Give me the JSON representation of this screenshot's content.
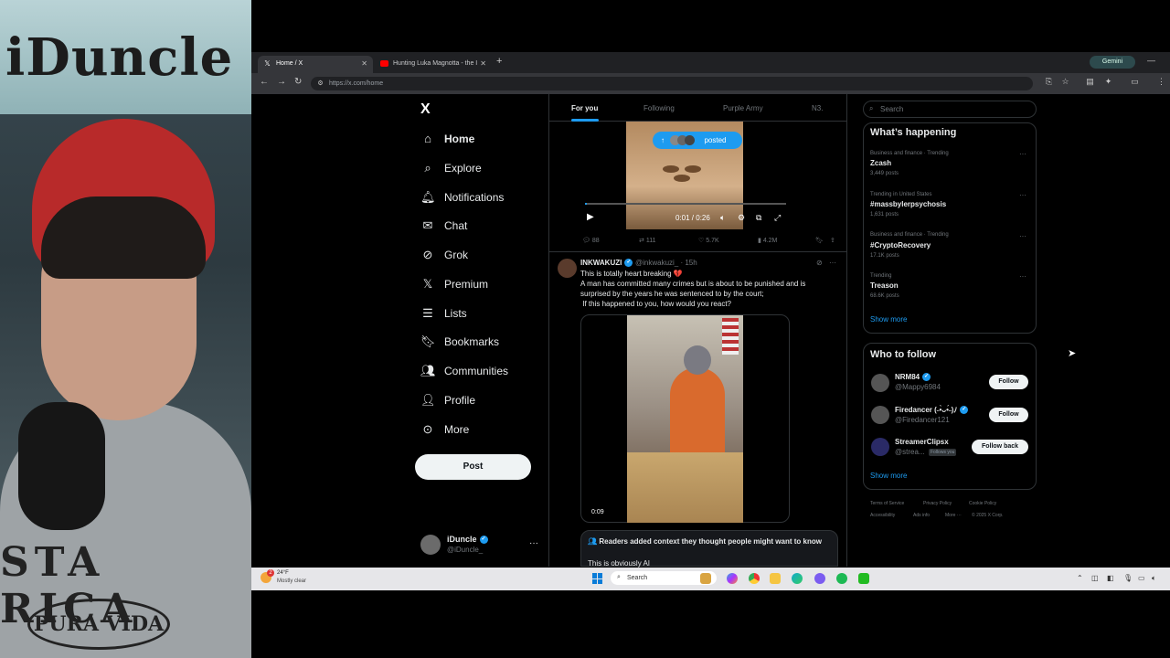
{
  "webcam": {
    "sign_text": "iDuncle",
    "shirt_text": "STA RICA",
    "shirt_logo": "PURA VIDA"
  },
  "browser": {
    "tabs": [
      {
        "title": "Home / X",
        "icon": "x-icon"
      },
      {
        "title": "Hunting Luka Magnotta - the I",
        "icon": "youtube-icon"
      }
    ],
    "new_tab_label": "+",
    "gemini_label": "Gemini",
    "url": "https://x.com/home"
  },
  "sidebar": {
    "logo": "X",
    "items": [
      {
        "label": "Home",
        "icon": "home-icon"
      },
      {
        "label": "Explore",
        "icon": "search-icon"
      },
      {
        "label": "Notifications",
        "icon": "bell-icon"
      },
      {
        "label": "Chat",
        "icon": "mail-icon"
      },
      {
        "label": "Grok",
        "icon": "grok-icon"
      },
      {
        "label": "Premium",
        "icon": "x-icon"
      },
      {
        "label": "Lists",
        "icon": "list-icon"
      },
      {
        "label": "Bookmarks",
        "icon": "bookmark-icon"
      },
      {
        "label": "Communities",
        "icon": "people-icon"
      },
      {
        "label": "Profile",
        "icon": "person-icon"
      },
      {
        "label": "More",
        "icon": "more-circle-icon"
      }
    ],
    "post_label": "Post",
    "account": {
      "name": "iDuncle",
      "handle": "@iDuncle_",
      "more": "···"
    }
  },
  "feed": {
    "tabs": [
      "For you",
      "Following",
      "Purple Army",
      "N3."
    ],
    "active_tab": "For you",
    "video1": {
      "posted_label": "posted",
      "time": "0:01 / 0:26",
      "actions": {
        "replies": "88",
        "reposts": "111",
        "likes": "5.7K",
        "views": "4.2M"
      }
    },
    "tweet2": {
      "name": "INKWAKUZI",
      "handle": "@inkwakuzi_ · 15h",
      "lines": [
        "This is totally heart breaking 💔",
        "A man has committed many crimes but is about to be punished and is",
        "surprised by the years he was sentenced to by the court;",
        " If this happened to you, how would you react?"
      ],
      "video_time": "0:09",
      "notes_title": "Readers added context they thought people might want to know",
      "notes_body": "This is obviously AI"
    }
  },
  "right": {
    "search_placeholder": "Search",
    "happening_title": "What’s happening",
    "trends": [
      {
        "meta": "Business and finance · Trending",
        "name": "Zcash",
        "count": "3,449 posts"
      },
      {
        "meta": "Trending in United States",
        "name": "#massbylerpsychosis",
        "count": "1,631 posts"
      },
      {
        "meta": "Business and finance · Trending",
        "name": "#CryptoRecovery",
        "count": "17.1K posts"
      },
      {
        "meta": "Trending",
        "name": "Treason",
        "count": "68.6K posts"
      }
    ],
    "show_more": "Show more",
    "follow_title": "Who to follow",
    "suggestions": [
      {
        "name": "NRM84",
        "handle": "@Mappy6984",
        "button": "Follow"
      },
      {
        "name": "Firedancer (˵•̀ᴗ•́˵)ﾉ",
        "handle": "@Firedancer121",
        "button": "Follow"
      },
      {
        "name": "StreamerClipsx",
        "handle": "@strea...",
        "button": "Follow back",
        "badge": "Follows you"
      }
    ],
    "footer": [
      "Terms of Service",
      "Privacy Policy",
      "Cookie Policy",
      "Accessibility",
      "Ads info",
      "More ···",
      "© 2025 X Corp."
    ]
  },
  "taskbar": {
    "weather_temp": "24°F",
    "weather_desc": "Mostly clear",
    "weather_badge": "2",
    "search_placeholder": "Search"
  },
  "colors": {
    "accent": "#1d9bf0",
    "background": "#000000",
    "text": "#e7e9ea",
    "muted": "#71767b"
  }
}
